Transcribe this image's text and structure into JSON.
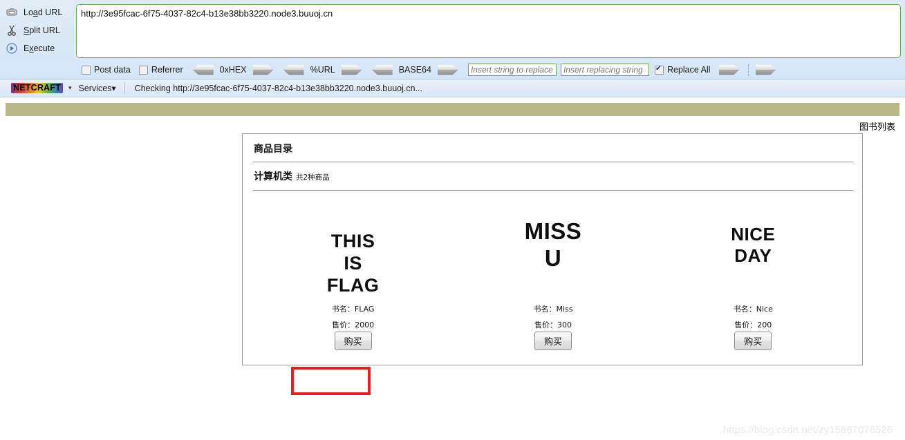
{
  "hackbar": {
    "commands": [
      {
        "label_pre": "Lo",
        "label_key": "a",
        "label_post": "d URL",
        "icon": "load-url-icon"
      },
      {
        "label_pre": "",
        "label_key": "S",
        "label_post": "plit URL",
        "icon": "split-url-icon"
      },
      {
        "label_pre": "E",
        "label_key": "x",
        "label_post": "ecute",
        "icon": "execute-icon"
      }
    ],
    "url_value": "http://3e95fcac-6f75-4037-82c4-b13e38bb3220.node3.buuoj.cn",
    "checkboxes": [
      {
        "label": "Post data",
        "checked": false
      },
      {
        "label": "Referrer",
        "checked": false
      }
    ],
    "encoders": [
      {
        "label": "0xHEX"
      },
      {
        "label": "%URL"
      },
      {
        "label": "BASE64"
      }
    ],
    "replace_find_placeholder": "Insert string to replace",
    "replace_with_placeholder": "Insert replacing string",
    "replace_all": {
      "label": "Replace All",
      "checked": true
    }
  },
  "netcraft": {
    "logo": "NETCRAFT",
    "caret": "▾",
    "services": "Services▾",
    "status": "Checking http://3e95fcac-6f75-4037-82c4-b13e38bb3220.node3.buuoj.cn..."
  },
  "page": {
    "booklist_label": "图书列表",
    "catalog_title": "商品目录",
    "category_name": "计算机类",
    "category_count": "共2种商品",
    "name_prefix": "书名：",
    "price_prefix": "售价：",
    "buy_label": "购买",
    "books": [
      {
        "cover_lines": "THIS\nIS\nFLAG",
        "name_line": "书名：FLAG",
        "price_line": "售价：2000",
        "title": "FLAG",
        "price": 2000
      },
      {
        "cover_lines": "MISS\nU",
        "name_line": "书名：Miss",
        "price_line": "售价：300",
        "title": "Miss",
        "price": 300
      },
      {
        "cover_lines": "NICE\nDAY",
        "name_line": "书名：Nice",
        "price_line": "售价：200",
        "title": "Nice",
        "price": 200
      }
    ]
  },
  "watermark": "https://blog.csdn.net/zy15667076526",
  "colors": {
    "olive_bar": "#b9b887",
    "annotation_red": "#ee1c1c",
    "url_border_green": "#6aa84f",
    "toolbar_blue": "#dcebf9"
  }
}
